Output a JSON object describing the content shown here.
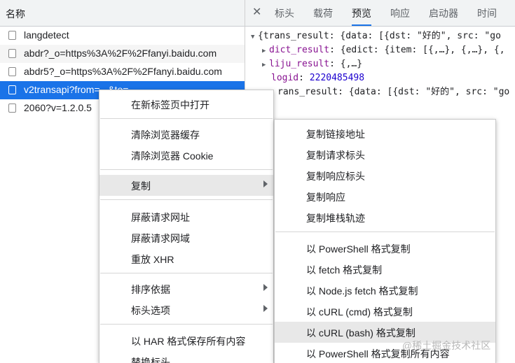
{
  "list": {
    "header": "名称",
    "rows": [
      {
        "name": "langdetect"
      },
      {
        "name": "abdr?_o=https%3A%2F%2Ffanyi.baidu.com"
      },
      {
        "name": "abdr5?_o=https%3A%2F%2Ffanyi.baidu.com"
      },
      {
        "name": "v2transapi?from=...&to=..."
      },
      {
        "name": "2060?v=1.2.0.5"
      }
    ]
  },
  "tabs": {
    "close_icon": "close-icon",
    "items": [
      "标头",
      "载荷",
      "预览",
      "响应",
      "启动器",
      "时间"
    ],
    "active": "预览"
  },
  "preview": {
    "line1": "{trans_result: {data: [{dst: \"好的\", src: \"go",
    "line2_key": "dict_result",
    "line2_rest": ": {edict: {item: [{,…}, {,…}, {,",
    "line3_key": "liju_result",
    "line3_rest": ": {,…}",
    "line4_key": "logid",
    "line4_val": "2220485498",
    "line5": "rans_result: {data: [{dst: \"好的\", src: \"go"
  },
  "context_menu": {
    "items": [
      "在新标签页中打开",
      "清除浏览器缓存",
      "清除浏览器 Cookie",
      "复制",
      "屏蔽请求网址",
      "屏蔽请求网域",
      "重放 XHR",
      "排序依据",
      "标头选项",
      "以 HAR 格式保存所有内容",
      "替换标头"
    ]
  },
  "copy_submenu": {
    "items": [
      "复制链接地址",
      "复制请求标头",
      "复制响应标头",
      "复制响应",
      "复制堆栈轨迹",
      "以 PowerShell 格式复制",
      "以 fetch 格式复制",
      "以 Node.js fetch 格式复制",
      "以 cURL (cmd) 格式复制",
      "以 cURL (bash) 格式复制",
      "以 PowerShell 格式复制所有内容"
    ]
  },
  "watermark": "@稀土掘金技术社区",
  "colors": {
    "selection": "#1a73e8",
    "menu_highlight": "#e8e8e8",
    "key": "#881391",
    "number": "#1c00cf"
  }
}
